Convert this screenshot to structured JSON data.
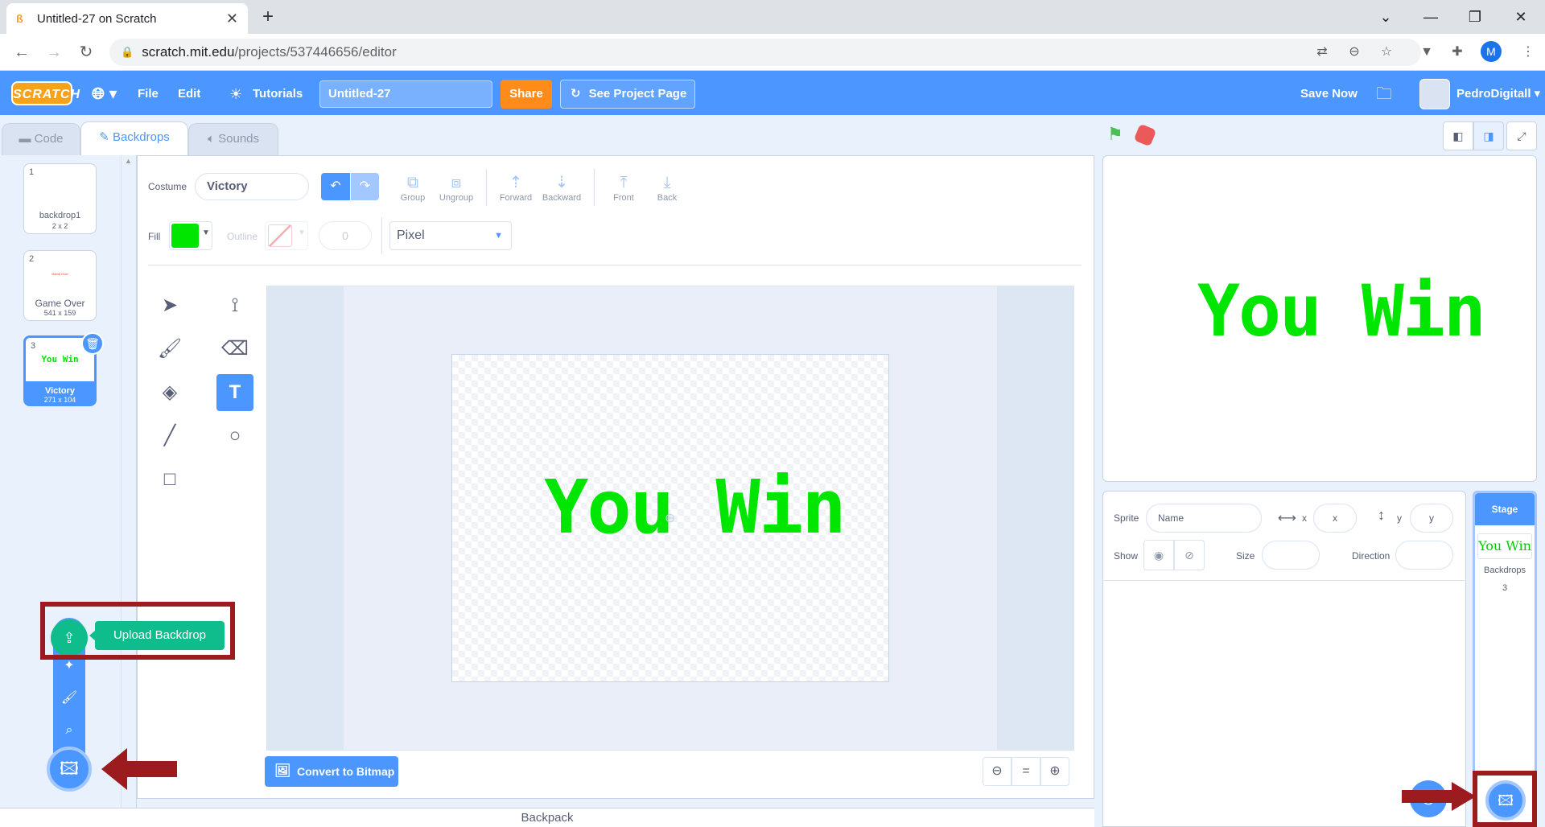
{
  "browser": {
    "tab_title": "Untitled-27 on Scratch",
    "url_host": "scratch.mit.edu",
    "url_path": "/projects/537446656/editor",
    "profile_initial": "M"
  },
  "menubar": {
    "logo": "SCRATCH",
    "file": "File",
    "edit": "Edit",
    "tutorials": "Tutorials",
    "project_title": "Untitled-27",
    "share": "Share",
    "see_project_page": "See Project Page",
    "save_now": "Save Now",
    "username": "PedroDigitall"
  },
  "editor_tabs": {
    "code": "Code",
    "backdrops": "Backdrops",
    "sounds": "Sounds"
  },
  "backdrops": [
    {
      "num": "1",
      "name": "backdrop1",
      "size": "2 x 2"
    },
    {
      "num": "2",
      "name": "Game Over",
      "size": "541 x 159",
      "preview": "Game Over"
    },
    {
      "num": "3",
      "name": "Victory",
      "size": "271 x 104",
      "preview": "You Win"
    }
  ],
  "paint": {
    "costume_label": "Costume",
    "costume_name": "Victory",
    "group": "Group",
    "ungroup": "Ungroup",
    "forward": "Forward",
    "backward": "Backward",
    "front": "Front",
    "back": "Back",
    "fill_label": "Fill",
    "outline_label": "Outline",
    "outline_width": "0",
    "font": "Pixel",
    "fill_color": "#00e600",
    "canvas_text": "You Win",
    "convert": "Convert to Bitmap"
  },
  "add_menu": {
    "upload_tooltip": "Upload Backdrop"
  },
  "backpack": "Backpack",
  "sprite_info": {
    "sprite_label": "Sprite",
    "name_placeholder": "Name",
    "x_label": "x",
    "x_placeholder": "x",
    "y_label": "y",
    "y_placeholder": "y",
    "show_label": "Show",
    "size_label": "Size",
    "direction_label": "Direction"
  },
  "stage": {
    "text": "You Win",
    "header": "Stage",
    "thumb_text": "You Win",
    "backdrops_label": "Backdrops",
    "backdrops_count": "3"
  }
}
